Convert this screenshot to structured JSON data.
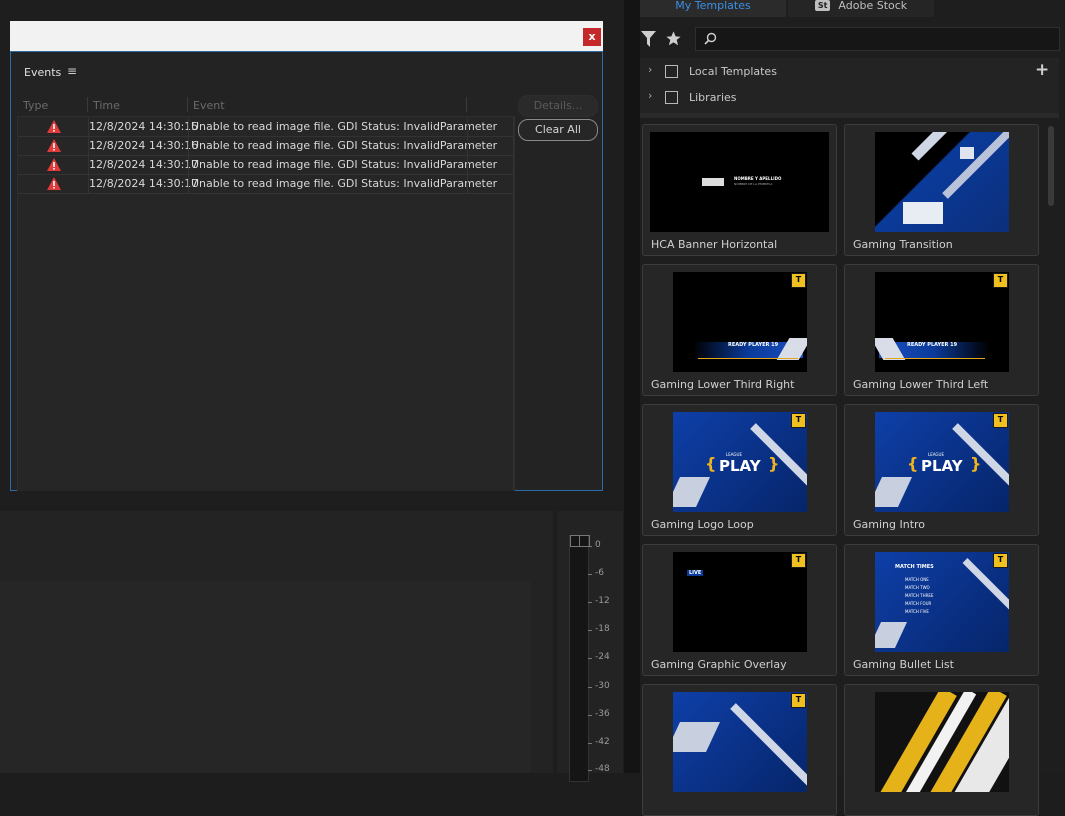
{
  "events_dialog": {
    "close_label": "x",
    "title": "Events",
    "menu_icon": "hamburger-icon",
    "columns": {
      "type": "Type",
      "time": "Time",
      "event": "Event"
    },
    "rows": [
      {
        "time": "12/8/2024 14:30:15",
        "message": "Unable to read image file. GDI Status: InvalidParameter",
        "icon": "warning-icon"
      },
      {
        "time": "12/8/2024 14:30:16",
        "message": "Unable to read image file. GDI Status: InvalidParameter",
        "icon": "warning-icon"
      },
      {
        "time": "12/8/2024 14:30:17",
        "message": "Unable to read image file. GDI Status: InvalidParameter",
        "icon": "warning-icon"
      },
      {
        "time": "12/8/2024 14:30:17",
        "message": "Unable to read image file. GDI Status: InvalidParameter",
        "icon": "warning-icon"
      }
    ],
    "details_label": "Details...",
    "clear_all_label": "Clear All"
  },
  "audio_meter": {
    "ticks": [
      "0",
      "-6",
      "-12",
      "-18",
      "-24",
      "-30",
      "-36",
      "-42",
      "-48"
    ]
  },
  "templates_panel": {
    "tabs": [
      {
        "label": "My Templates",
        "active": true
      },
      {
        "label": "Adobe Stock",
        "badge": "St"
      }
    ],
    "search_placeholder": "",
    "libraries": [
      {
        "label": "Local Templates"
      },
      {
        "label": "Libraries"
      }
    ],
    "templates": [
      {
        "name": "HCA Banner Horizontal",
        "thumb_text": "NOMBRE Y APELLIDO",
        "thumb_subtext": "NOMBRE DE LA EMPRESA"
      },
      {
        "name": "Gaming Transition"
      },
      {
        "name": "Gaming Lower Third Right",
        "thumb_text": "READY PLAYER 19",
        "badge": "T"
      },
      {
        "name": "Gaming Lower Third Left",
        "thumb_text": "READY PLAYER 19",
        "badge": "T"
      },
      {
        "name": "Gaming Logo Loop",
        "thumb_text": "PLAY",
        "thumb_subtext": "LEAGUE",
        "badge": "T"
      },
      {
        "name": "Gaming Intro",
        "thumb_text": "PLAY",
        "thumb_subtext": "LEAGUE",
        "badge": "T"
      },
      {
        "name": "Gaming Graphic Overlay",
        "thumb_text": "LIVE",
        "badge": "T"
      },
      {
        "name": "Gaming Bullet List",
        "thumb_text": "MATCH TIMES",
        "bullets": [
          "MATCH ONE",
          "MATCH TWO",
          "MATCH THREE",
          "MATCH FOUR",
          "MATCH FIVE"
        ],
        "badge": "T"
      },
      {
        "name": "",
        "badge": "T"
      },
      {
        "name": ""
      }
    ]
  },
  "colors": {
    "accent": "#3a8ee6",
    "warning": "#e03a3a",
    "close": "#c5282a",
    "badge": "#f0c020"
  }
}
